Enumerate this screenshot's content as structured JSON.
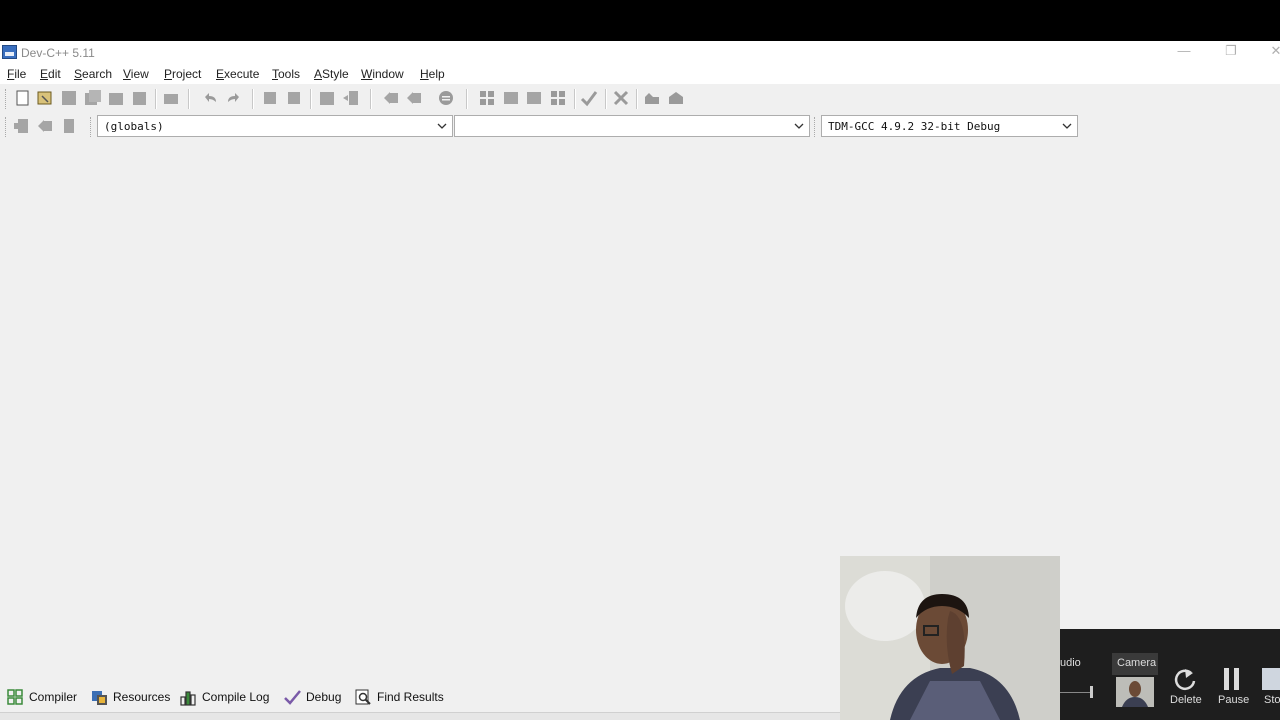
{
  "window": {
    "title": "Dev-C++ 5.11",
    "controls": {
      "minimize": "—",
      "restore": "❐",
      "close": "✕"
    }
  },
  "menu": {
    "items": [
      "File",
      "Edit",
      "Search",
      "View",
      "Project",
      "Execute",
      "Tools",
      "AStyle",
      "Window",
      "Help"
    ]
  },
  "toolbar2": {
    "scope_combo": "(globals)",
    "members_combo": "",
    "compiler_combo": "TDM-GCC 4.9.2 32-bit Debug"
  },
  "bottom_tabs": [
    {
      "label": "Compiler",
      "icon": "grid-icon"
    },
    {
      "label": "Resources",
      "icon": "resources-icon"
    },
    {
      "label": "Compile Log",
      "icon": "bar-chart-icon"
    },
    {
      "label": "Debug",
      "icon": "check-icon"
    },
    {
      "label": "Find Results",
      "icon": "find-icon"
    }
  ],
  "recorder": {
    "audio_label": "udio",
    "camera_label": "Camera",
    "delete_label": "Delete",
    "pause_label": "Pause",
    "stop_label": "Sto"
  },
  "colors": {
    "window_bg": "#f0f0f0",
    "toolbar_icon": "#9a9a9a",
    "recorder_bg": "#1e1e1e"
  }
}
